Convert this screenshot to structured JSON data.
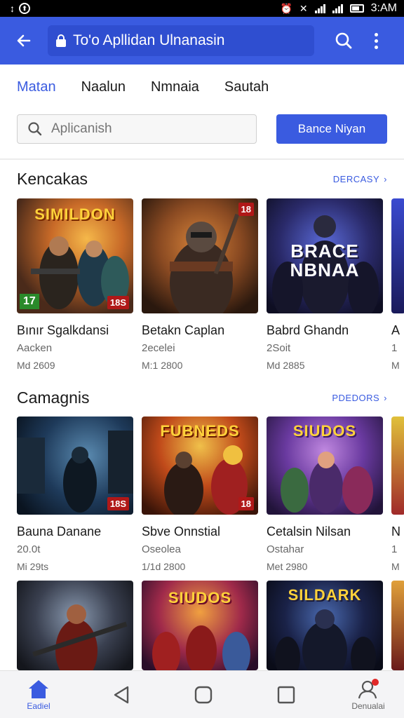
{
  "status_bar": {
    "time": "3:AM"
  },
  "app_bar": {
    "url_text": "To'o Apllidan Ulnanasin"
  },
  "tabs": [
    {
      "label": "Matan",
      "active": true
    },
    {
      "label": "Naalun",
      "active": false
    },
    {
      "label": "Nmnaia",
      "active": false
    },
    {
      "label": "Sautah",
      "active": false
    }
  ],
  "search": {
    "placeholder": "Aplicanish",
    "button_label": "Bance Niyan"
  },
  "sections": [
    {
      "title": "Kencakas",
      "link_label": "DERCASY",
      "cards": [
        {
          "title": "Bınır Sgalkdansi",
          "sub": "Aacken",
          "meta": "Md 2609",
          "art_title": "SIMILDON",
          "rating": "17",
          "badge": "18S"
        },
        {
          "title": "Betakn Caplan",
          "sub": "2ecelei",
          "meta": "M:1 2800",
          "art_title": "",
          "rating": "",
          "badge": "18"
        },
        {
          "title": "Babrd Ghandn",
          "sub": "2Soit",
          "meta": "Md 2885",
          "art_title": "BRACE NBNAA",
          "rating": "",
          "badge": ""
        },
        {
          "title": "A",
          "sub": "1",
          "meta": "M",
          "art_title": "",
          "rating": "",
          "badge": ""
        }
      ]
    },
    {
      "title": "Camagnis",
      "link_label": "PDEDORS",
      "cards": [
        {
          "title": "Bauna Danane",
          "sub": "20.0t",
          "meta": "Mi 29ts",
          "art_title": "",
          "rating": "",
          "badge": "18S"
        },
        {
          "title": "Sbve Onnstial",
          "sub": "Oseolea",
          "meta": "1/1d 2800",
          "art_title": "FUBNEDS",
          "rating": "",
          "badge": "18"
        },
        {
          "title": "Cetalsin Nilsan",
          "sub": "Ostahar",
          "meta": "Met 2980",
          "art_title": "SIUDOS",
          "rating": "",
          "badge": ""
        },
        {
          "title": "N",
          "sub": "1",
          "meta": "M",
          "art_title": "",
          "rating": "",
          "badge": ""
        }
      ]
    },
    {
      "title": "",
      "link_label": "",
      "cards": [
        {
          "title": "",
          "sub": "",
          "meta": "",
          "art_title": "",
          "rating": "",
          "badge": ""
        },
        {
          "title": "",
          "sub": "",
          "meta": "",
          "art_title": "SIUDOS",
          "rating": "",
          "badge": ""
        },
        {
          "title": "",
          "sub": "",
          "meta": "",
          "art_title": "SILDARK",
          "rating": "",
          "badge": ""
        },
        {
          "title": "",
          "sub": "",
          "meta": "",
          "art_title": "",
          "rating": "",
          "badge": ""
        }
      ]
    }
  ],
  "bottom_nav": [
    {
      "label": "Eadiel",
      "icon": "home-icon"
    },
    {
      "label": "",
      "icon": "back-triangle-icon"
    },
    {
      "label": "",
      "icon": "home-circle-icon"
    },
    {
      "label": "",
      "icon": "recents-square-icon"
    },
    {
      "label": "Denualai",
      "icon": "profile-icon"
    }
  ],
  "colors": {
    "accent": "#3a5be0",
    "status_bar": "#000000",
    "badge": "#b01818",
    "rating": "#2a8a2a",
    "notification_dot": "#e02828"
  }
}
